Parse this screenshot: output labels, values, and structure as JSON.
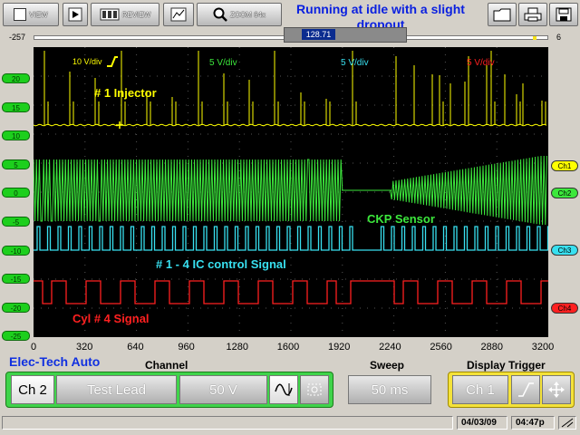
{
  "toolbar": {
    "view": "VIEW",
    "play_icon": "play-icon",
    "review": "REVIEW",
    "zoom": "ZOOM 64x",
    "title": "Running at idle with a slight dropout"
  },
  "timeline": {
    "left": "-257",
    "right": "6",
    "value": "128.71"
  },
  "scope": {
    "y_ticks": [
      "20",
      "15",
      "10",
      "5",
      "0",
      "-5",
      "-10",
      "-15",
      "-20",
      "-25"
    ],
    "x_ticks": [
      "0",
      "320",
      "640",
      "960",
      "1280",
      "1600",
      "1920",
      "2240",
      "2560",
      "2880",
      "3200"
    ],
    "scale_labels": {
      "ch1": "10 V/div",
      "ch2": "5 V/div",
      "ch3": "5 V/div",
      "ch4": "5 V/div"
    },
    "annotations": {
      "injector": "# 1 Injector",
      "ckp": "CKP Sensor",
      "ic": "# 1 - 4 IC control Signal",
      "cyl": "Cyl # 4 Signal"
    },
    "channels": [
      {
        "label": "Ch1",
        "color": "#ffff00"
      },
      {
        "label": "Ch2",
        "color": "#3ce83c"
      },
      {
        "label": "Ch3",
        "color": "#38e0f0"
      },
      {
        "label": "Ch4",
        "color": "#ff2020"
      }
    ]
  },
  "controls": {
    "brand": "Elec-Tech Auto",
    "channel_label": "Channel",
    "sweep_label": "Sweep",
    "trigger_label": "Display Trigger",
    "channel": "Ch 2",
    "probe": "Test Lead",
    "volts": "50 V",
    "sweep": "50 ms",
    "trigger_channel": "Ch 1"
  },
  "status": {
    "date": "04/03/09",
    "time": "04:47p"
  }
}
